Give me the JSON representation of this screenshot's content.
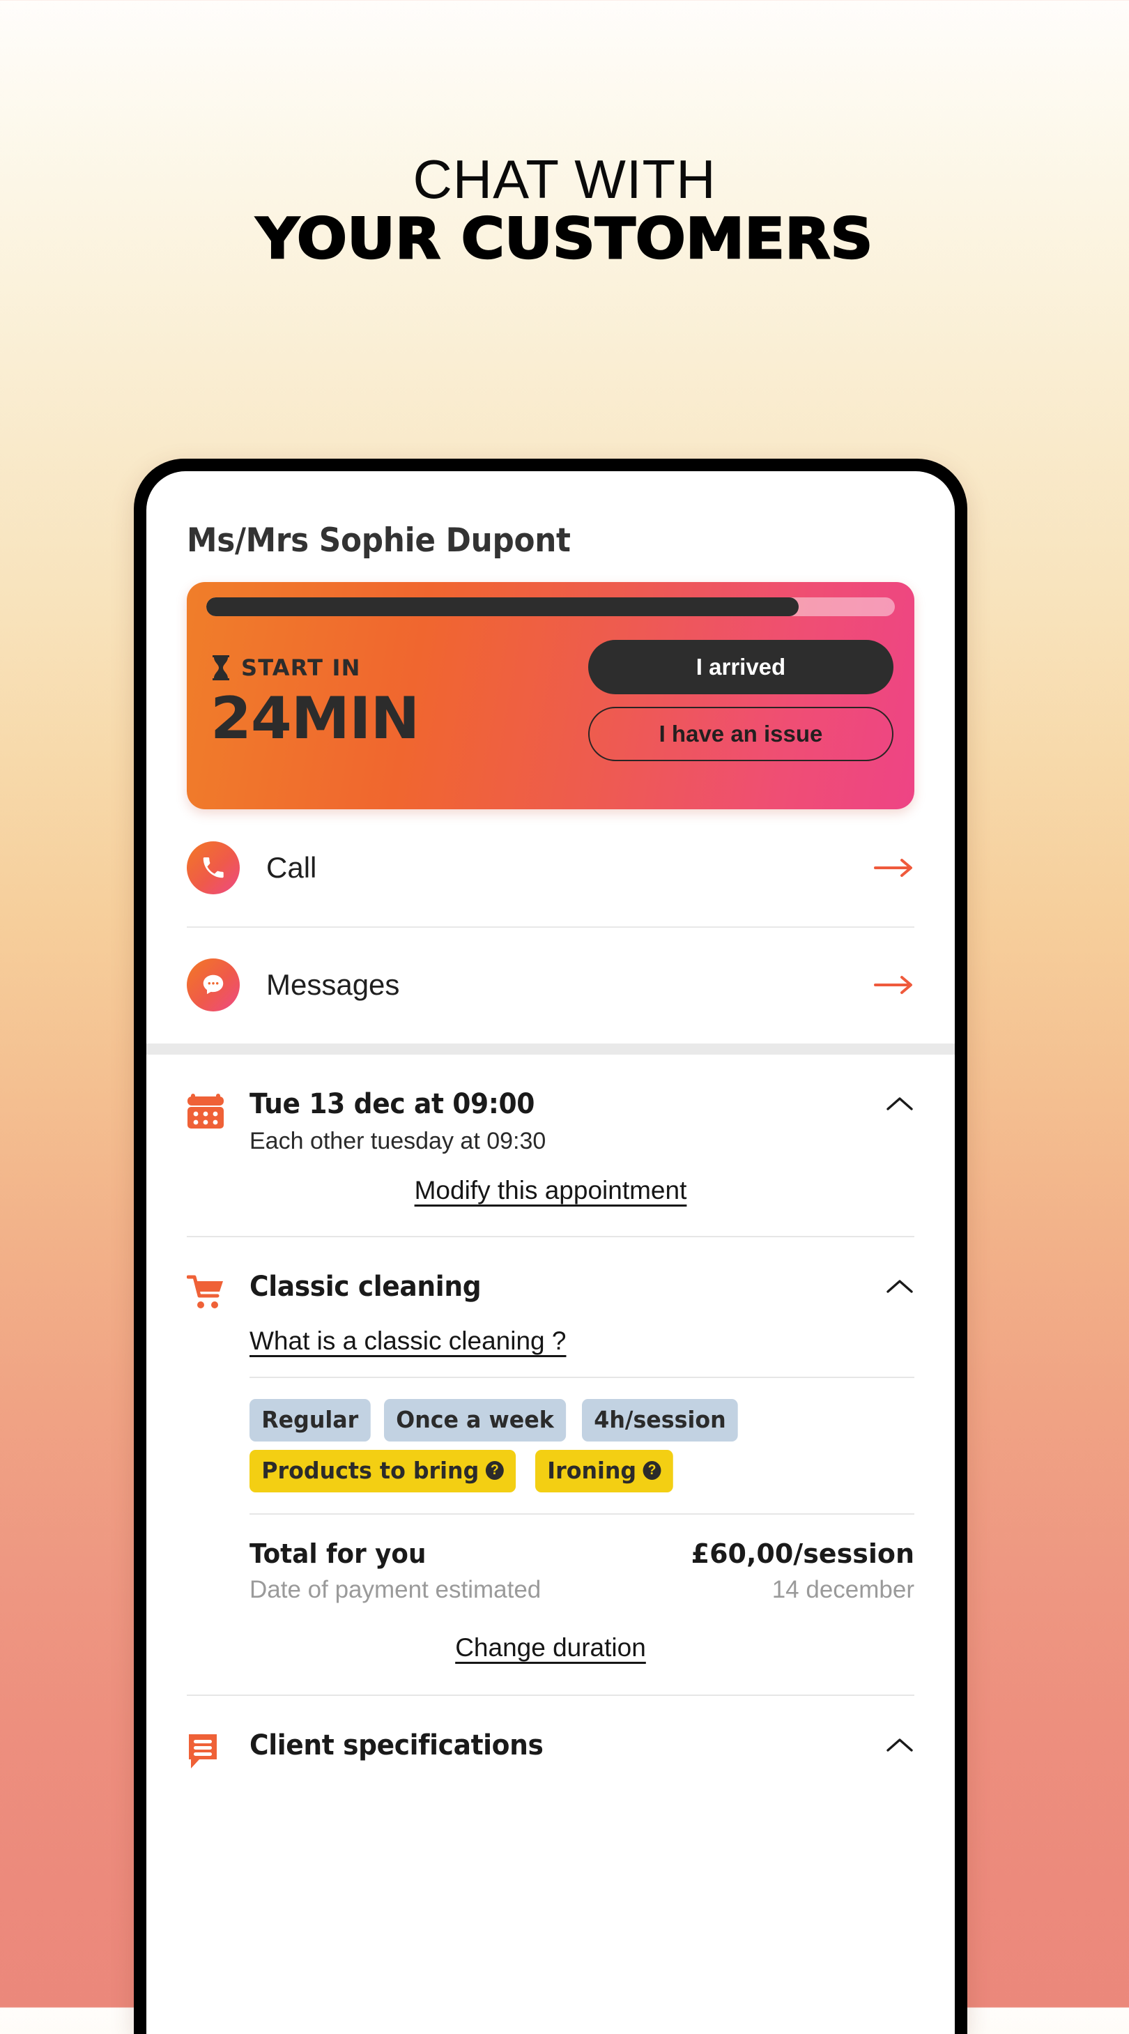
{
  "promo": {
    "line1": "CHAT WITH",
    "line2": "YOUR CUSTOMERS"
  },
  "colors": {
    "accent_orange": "#F0662F",
    "accent_pink": "#EE4485",
    "chip_blue": "#C2D2E2",
    "chip_yellow": "#F3CF13",
    "dark": "#2D2D2D",
    "muted": "#9A9A9A"
  },
  "screen": {
    "client_name": "Ms/Mrs Sophie Dupont",
    "countdown": {
      "progress_percent": 86,
      "label": "START IN",
      "value": "24MIN",
      "arrived_button": "I arrived",
      "issue_button": "I have an issue"
    },
    "contacts": [
      {
        "label": "Call",
        "icon": "phone-icon"
      },
      {
        "label": "Messages",
        "icon": "chat-bubble-icon"
      }
    ],
    "appointment": {
      "icon": "calendar-icon",
      "title": "Tue 13 dec at 09:00",
      "subtitle": "Each other tuesday at 09:30",
      "link": "Modify this appointment",
      "chevron": "chevron-up-icon"
    },
    "service": {
      "icon": "cart-icon",
      "title": "Classic cleaning",
      "link": "What is a classic cleaning ?",
      "chevron": "chevron-up-icon",
      "chips": [
        {
          "label": "Regular",
          "style": "blue",
          "help": false
        },
        {
          "label": "Once a week",
          "style": "blue",
          "help": false
        },
        {
          "label": "4h/session",
          "style": "blue",
          "help": false
        },
        {
          "label": "Products to bring",
          "style": "yellow",
          "help": true
        },
        {
          "label": "Ironing",
          "style": "yellow",
          "help": true
        }
      ],
      "help_glyph": "?",
      "total_label": "Total for you",
      "total_value": "£60,00/session",
      "payment_label": "Date of payment estimated",
      "payment_value": "14 december",
      "duration_link": "Change duration"
    },
    "client_specs": {
      "icon": "speech-list-icon",
      "title": "Client specifications",
      "chevron": "chevron-up-icon"
    }
  }
}
